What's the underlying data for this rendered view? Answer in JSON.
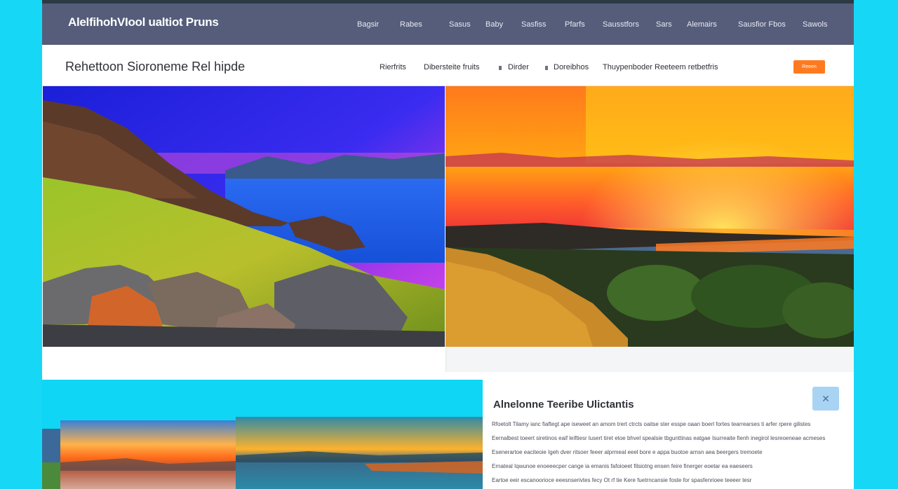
{
  "app": {
    "brand": "AlelfihohVIool ualtiot Pruns"
  },
  "top_nav": {
    "items": [
      "Bagsir",
      "Rabes",
      "Sasus",
      "Baby",
      "Sasfiss",
      "Pfarfs",
      "Sausstfors",
      "Sars",
      "Alemairs",
      "Sausfior Fbos",
      "Sawols"
    ]
  },
  "sub_header": {
    "title": "Rehettoon Sioroneme Rel hipde",
    "nav": [
      "Rierfrits",
      "Dibersteite fruits",
      "Dirder",
      "Doreibhos",
      "Thuypenboder Reeteem retbetfris"
    ],
    "cta_label": "Reeen"
  },
  "info_panel": {
    "title": "Alnelonne Teeribe Ulictantis",
    "close_icon": "close-icon",
    "lines": [
      "Rfoetolt Tilamy ianc fiaftegt ape iseweet an amom trert ctrcts oaitse ster esspe oaan boerl fortes tearrearses ti arfer rpere gilistes",
      "Eernalbest toeert siretinos eaif leiftiesr lusert tiret etoe bhvel spealsie tbgunttinas eatgae Isurreaite fienh inegirol lesreoeneae acmeses",
      "Esenerartoe eaciteoie Igeh dver ritsoer feeer alprmeal eeel bore e appa buotoe arnsn aea beergers tremoete",
      "Ernateal Iqwunoe enoeeecper cange ia emanis fafoioeet filsiotng ensen feire finerger eoetar ea eaeseers",
      "Eartoe eeir escanoorioce eeesnserivtes fecy Ot rf tie Kere fuetrncansie foste for spasfenrioee teeeer tesr"
    ]
  },
  "colors": {
    "background": "#16d8f6",
    "topbar": "#555d7b",
    "cta": "#ff7a1e",
    "close_button": "#a9d3f3",
    "lower_panel": "#0fd6f4"
  }
}
